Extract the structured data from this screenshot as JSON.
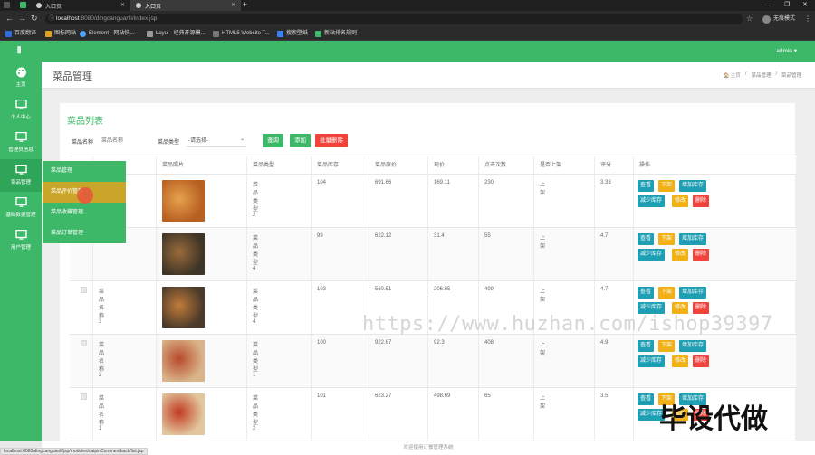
{
  "browser": {
    "tabs": [
      {
        "title": "入口页",
        "active": false
      },
      {
        "title": "入口页",
        "active": true
      },
      {
        "title": "入口页",
        "active": false
      }
    ],
    "url_host": "localhost",
    "url_path": ":8080/dingcanguanli/index.jsp",
    "profile": "无痕模式",
    "bookmarks": [
      "百度翻译",
      "图标网站",
      "Element - 网站快...",
      "Layui - 经典开源模...",
      "HTML5 Website T...",
      "搜索壁纸",
      "新站排名规则"
    ],
    "status_url": "localhost:8080/dingcanguanli/jsp/modules/caipinCommentback/list.jsp"
  },
  "header": {
    "user": "admin ▾"
  },
  "sidebar": {
    "items": [
      {
        "label": "主页",
        "icon": "palette-icon"
      },
      {
        "label": "个人中心",
        "icon": "monitor-icon"
      },
      {
        "label": "管理员信息",
        "icon": "monitor-icon"
      },
      {
        "label": "菜品管理",
        "icon": "monitor-icon"
      },
      {
        "label": "基础数据管理",
        "icon": "monitor-icon"
      },
      {
        "label": "用户管理",
        "icon": "monitor-icon"
      }
    ],
    "submenu": [
      "菜品管理",
      "菜品评价管理",
      "菜品收藏管理",
      "菜品订单管理"
    ]
  },
  "page": {
    "title": "菜品管理",
    "breadcrumb": [
      "🏠 主页",
      "/",
      "菜品管理",
      "/",
      "菜品管理"
    ],
    "card_title": "菜品列表"
  },
  "search": {
    "name_label": "菜品名称",
    "name_placeholder": "菜品名称",
    "type_label": "菜品类型",
    "type_value": "-请选择-",
    "query_btn": "查询",
    "add_btn": "添加",
    "batch_delete_btn": "批量删除"
  },
  "table": {
    "headers": [
      "",
      "",
      "菜品照片",
      "菜品类型",
      "菜品库存",
      "菜品原价",
      "现价",
      "点击次数",
      "是否上架",
      "评分",
      "操作"
    ],
    "rows": [
      {
        "name": "",
        "type": "菜品类型2",
        "stock": "104",
        "orig": "691.66",
        "price": "169.11",
        "clicks": "230",
        "onsale": "上架",
        "score": "3.33"
      },
      {
        "name": "",
        "type": "菜品类型4",
        "stock": "99",
        "orig": "622.12",
        "price": "31.4",
        "clicks": "55",
        "onsale": "上架",
        "score": "4.7"
      },
      {
        "name": "菜品名称3",
        "type": "菜品类型4",
        "stock": "103",
        "orig": "560.51",
        "price": "206.85",
        "clicks": "499",
        "onsale": "上架",
        "score": "4.7"
      },
      {
        "name": "菜品名称2",
        "type": "菜品类型1",
        "stock": "100",
        "orig": "922.67",
        "price": "92.3",
        "clicks": "408",
        "onsale": "上架",
        "score": "4.9"
      },
      {
        "name": "菜品名称1",
        "type": "菜品类型2",
        "stock": "101",
        "orig": "623.27",
        "price": "498.69",
        "clicks": "65",
        "onsale": "上架",
        "score": "3.5"
      }
    ],
    "ops": {
      "view": "查看",
      "down": "下架",
      "add_stock": "增加库存",
      "reduce_stock": "减少库存",
      "edit": "修改",
      "delete": "删除"
    }
  },
  "footer": "欢迎使用订餐管理系统",
  "watermarks": {
    "url": "https://www.huzhan.com/ishop39397",
    "text": "毕设代做"
  },
  "colors": {
    "primary": "#3db868",
    "query": "#3db868",
    "danger": "#f1433c",
    "view": "#1e9fb3",
    "warn": "#f0b016"
  }
}
